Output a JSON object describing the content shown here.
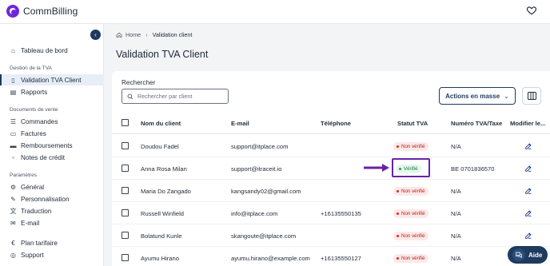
{
  "app": {
    "name": "CommBilling"
  },
  "sidebar": {
    "collapse_icon": "chevron-left-icon",
    "top_items": [
      {
        "label": "Tableau de bord",
        "icon": "home-icon"
      }
    ],
    "sections": [
      {
        "title": "Gestion de la TVA",
        "items": [
          {
            "label": "Validation TVA Client",
            "icon": "document-icon",
            "active": true
          },
          {
            "label": "Rapports",
            "icon": "report-icon"
          }
        ]
      },
      {
        "title": "Documents de vente",
        "items": [
          {
            "label": "Commandes",
            "icon": "list-icon"
          },
          {
            "label": "Factures",
            "icon": "invoice-icon"
          },
          {
            "label": "Remboursements",
            "icon": "refund-icon"
          },
          {
            "label": "Notes de crédit",
            "icon": "credit-note-icon"
          }
        ]
      },
      {
        "title": "Paramètres",
        "items": [
          {
            "label": "Général",
            "icon": "settings-icon"
          },
          {
            "label": "Personnalisation",
            "icon": "customize-icon"
          },
          {
            "label": "Traduction",
            "icon": "translate-icon"
          },
          {
            "label": "E-mail",
            "icon": "mail-icon"
          }
        ]
      }
    ],
    "bottom_items": [
      {
        "label": "Plan tarifaire",
        "icon": "pricing-icon"
      },
      {
        "label": "Support",
        "icon": "support-icon"
      }
    ]
  },
  "breadcrumb": {
    "home": "Home",
    "current": "Validation client"
  },
  "page": {
    "title": "Validation TVA Client"
  },
  "search": {
    "label": "Rechercher",
    "placeholder": "Rechercher par client"
  },
  "toolbar": {
    "mass_actions_label": "Actions en masse"
  },
  "table": {
    "headers": {
      "name": "Nom du client",
      "email": "E-mail",
      "phone": "Téléphone",
      "status": "Statut TVA",
      "vat": "Numéro TVA/Taxe",
      "edit": "Modifier le..."
    },
    "rows": [
      {
        "name": "Doudou Fadel",
        "email": "support@itplace.com",
        "phone": "",
        "status": "Non vérifié",
        "status_type": "bad",
        "vat": "N/A"
      },
      {
        "name": "Anna Rosa Milan",
        "email": "support@itraceit.io",
        "phone": "",
        "status": "Vérifié",
        "status_type": "good",
        "vat": "BE 0701836570"
      },
      {
        "name": "Maria Do Zangado",
        "email": "kangsandy02@gmail.com",
        "phone": "",
        "status": "Non vérifié",
        "status_type": "bad",
        "vat": "N/A"
      },
      {
        "name": "Russell Winfield",
        "email": "info@itplace.com",
        "phone": "+16135550135",
        "status": "Non vérifié",
        "status_type": "bad",
        "vat": "N/A"
      },
      {
        "name": "Bolatund Kunle",
        "email": "skangoute@itplace.com",
        "phone": "",
        "status": "Non vérifié",
        "status_type": "bad",
        "vat": "N/A"
      },
      {
        "name": "Ayumu Hirano",
        "email": "ayumu.hirano@example.com",
        "phone": "+16135550127",
        "status": "Non vérifié",
        "status_type": "bad",
        "vat": "N/A"
      }
    ]
  },
  "help": {
    "label": "Aide"
  },
  "colors": {
    "brand": "#6d28d9",
    "navy": "#1e3a5f",
    "annotation": "#6b21a8"
  }
}
